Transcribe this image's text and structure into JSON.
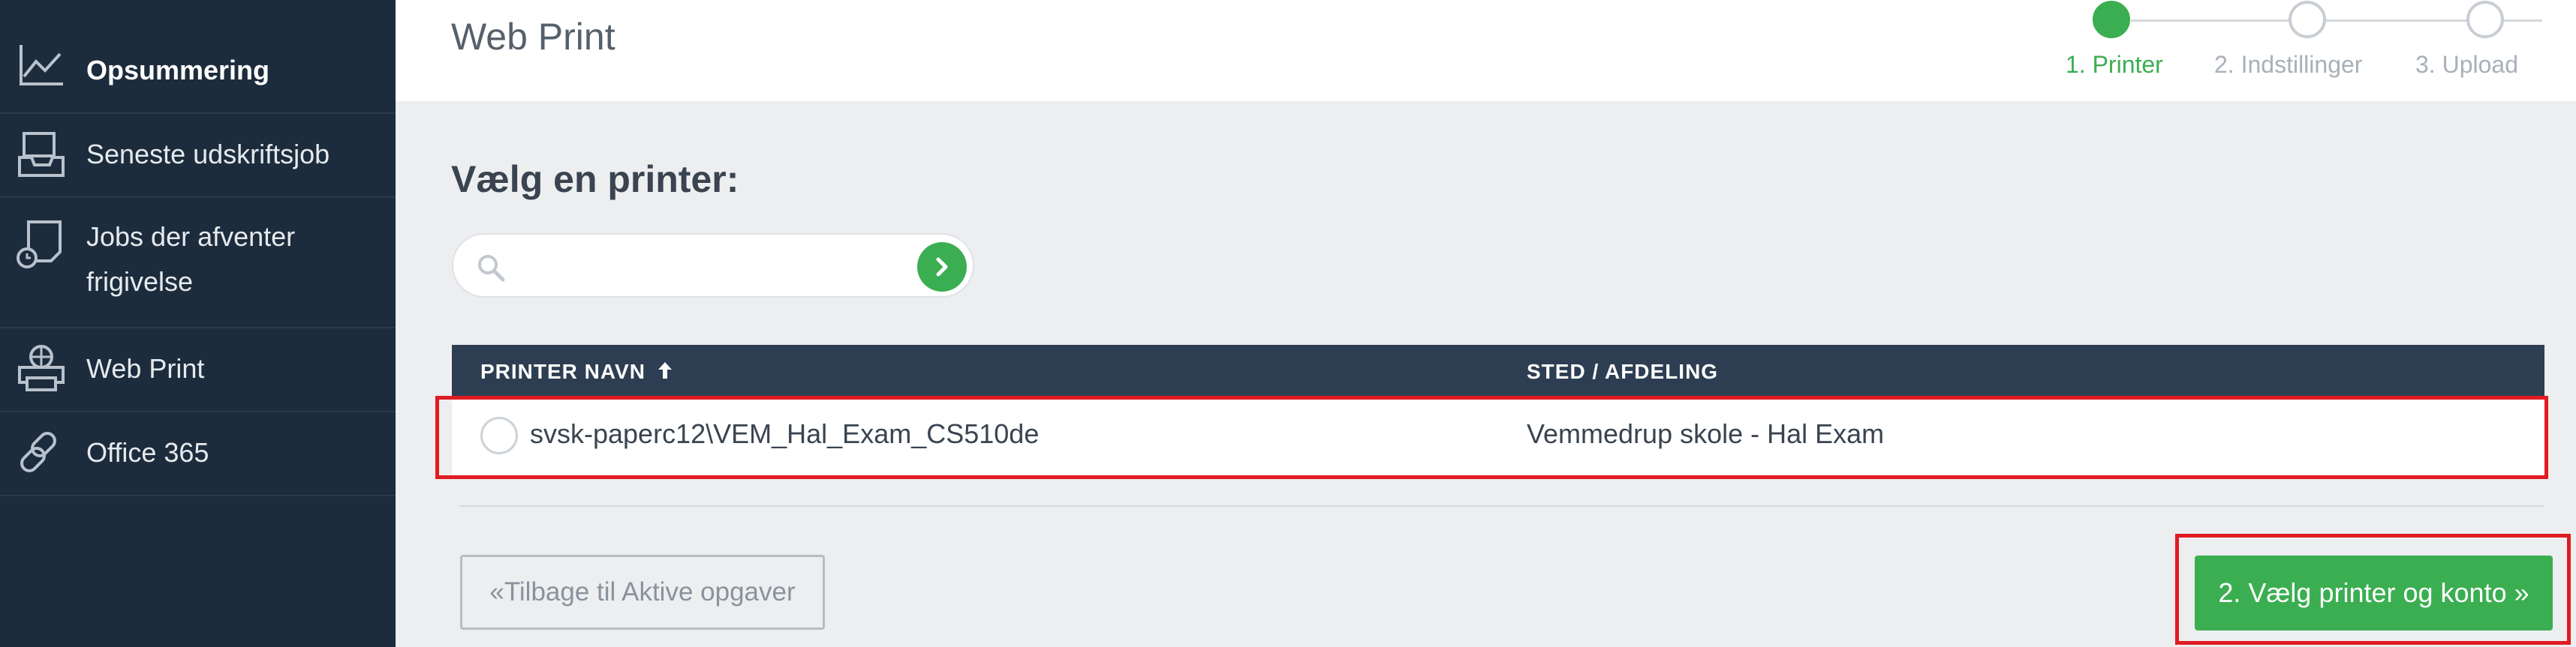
{
  "sidebar": {
    "items": [
      {
        "label": "Opsummering",
        "icon": "line-chart-icon"
      },
      {
        "label": "Seneste udskriftsjob",
        "icon": "inbox-tray-icon"
      },
      {
        "label_line1": "Jobs der afventer",
        "label_line2": "frigivelse",
        "icon": "pending-release-icon"
      },
      {
        "label": "Web Print",
        "icon": "web-printer-icon"
      },
      {
        "label": "Office 365",
        "icon": "link-icon"
      }
    ]
  },
  "header": {
    "title": "Web Print",
    "steps": [
      {
        "label": "1. Printer",
        "active": true
      },
      {
        "label": "2. Indstillinger",
        "active": false
      },
      {
        "label": "3. Upload",
        "active": false
      }
    ]
  },
  "main": {
    "heading": "Vælg en printer:",
    "search": {
      "value": "",
      "placeholder": ""
    },
    "table": {
      "columns": [
        "PRINTER NAVN",
        "STED / AFDELING"
      ],
      "rows": [
        {
          "name": "svsk-paperc12\\VEM_Hal_Exam_CS510de",
          "location": "Vemmedrup skole - Hal Exam"
        }
      ]
    },
    "back_button": "«Tilbage til Aktive opgaver",
    "next_button": "2. Vælg printer og konto »"
  },
  "colors": {
    "sidebar_bg": "#1d2c3d",
    "accent_green": "#3bae51",
    "table_header_bg": "#2e3e52",
    "highlight_red": "#e01b22"
  }
}
